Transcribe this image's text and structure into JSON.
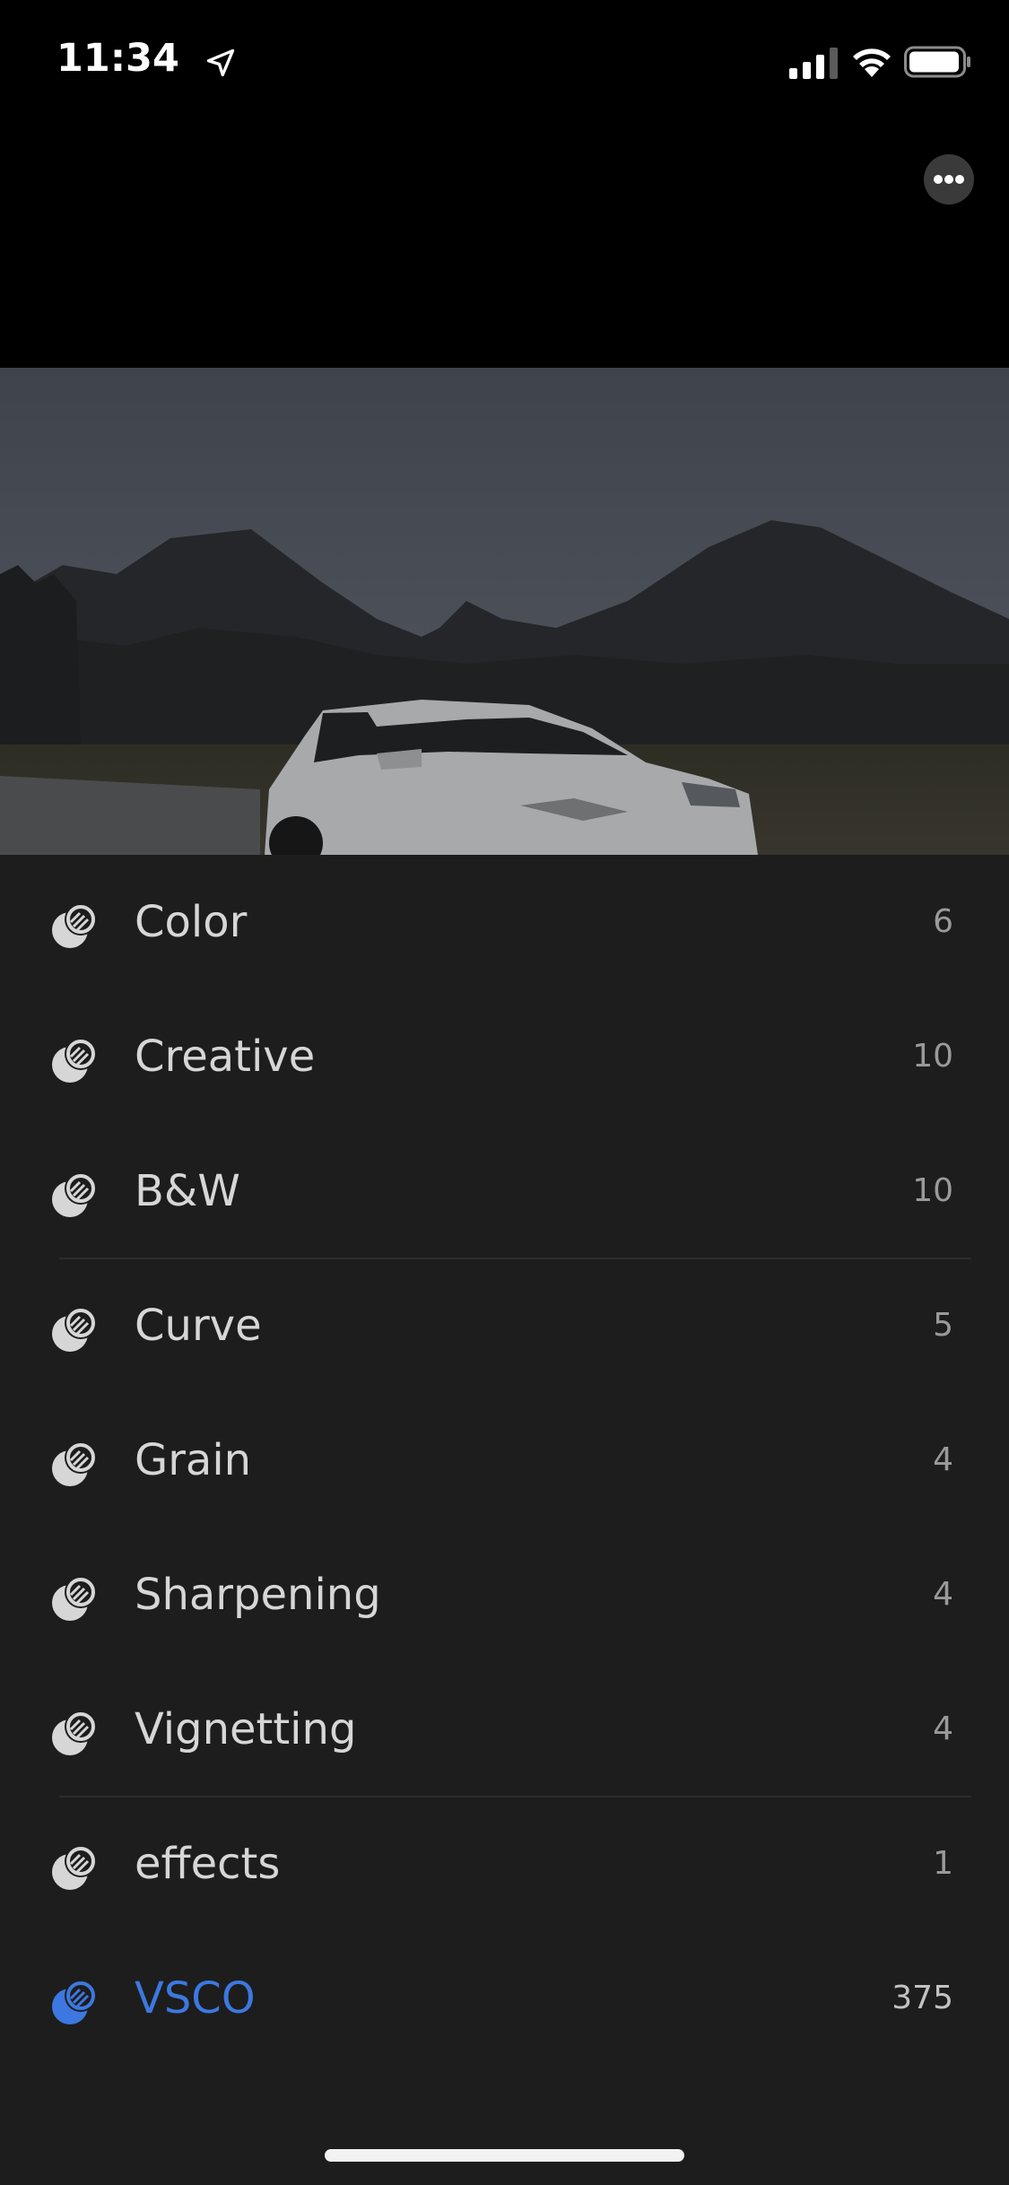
{
  "status_bar": {
    "time": "11:34"
  },
  "presets": [
    {
      "label": "Color",
      "count": "6"
    },
    {
      "label": "Creative",
      "count": "10"
    },
    {
      "label": "B&W",
      "count": "10"
    },
    {
      "label": "Curve",
      "count": "5"
    },
    {
      "label": "Grain",
      "count": "4"
    },
    {
      "label": "Sharpening",
      "count": "4"
    },
    {
      "label": "Vignetting",
      "count": "4"
    },
    {
      "label": "effects",
      "count": "1"
    },
    {
      "label": "VSCO",
      "count": "375"
    }
  ],
  "colors": {
    "background": "#1d1d1d",
    "accent": "#3c78e0"
  }
}
